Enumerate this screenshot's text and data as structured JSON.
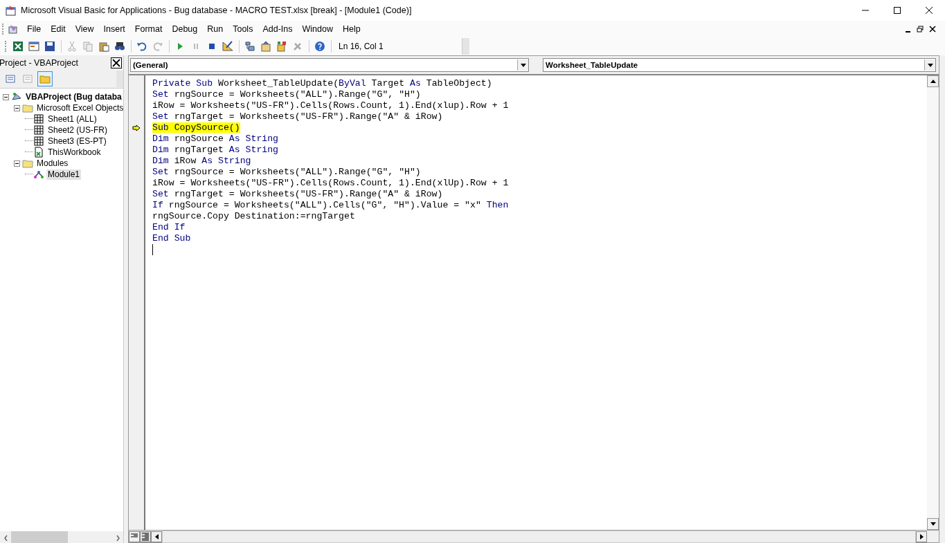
{
  "window": {
    "title": "Microsoft Visual Basic for Applications - Bug database - MACRO TEST.xlsx [break] - [Module1 (Code)]"
  },
  "menu": [
    {
      "label": "File"
    },
    {
      "label": "Edit"
    },
    {
      "label": "View"
    },
    {
      "label": "Insert"
    },
    {
      "label": "Format"
    },
    {
      "label": "Debug"
    },
    {
      "label": "Run"
    },
    {
      "label": "Tools"
    },
    {
      "label": "Add-Ins"
    },
    {
      "label": "Window"
    },
    {
      "label": "Help"
    }
  ],
  "toolbar": {
    "position": "Ln 16, Col 1"
  },
  "project_panel": {
    "title": "Project - VBAProject",
    "tree": [
      {
        "label": "VBAProject (Bug databa",
        "kind": "project",
        "expanded": true,
        "selected": false,
        "children": [
          {
            "label": "Microsoft Excel Objects",
            "kind": "folder",
            "expanded": true,
            "selected": false,
            "children": [
              {
                "label": "Sheet1 (ALL)",
                "kind": "sheet",
                "selected": false
              },
              {
                "label": "Sheet2 (US-FR)",
                "kind": "sheet",
                "selected": false
              },
              {
                "label": "Sheet3 (ES-PT)",
                "kind": "sheet",
                "selected": false
              },
              {
                "label": "ThisWorkbook",
                "kind": "workbook",
                "selected": false
              }
            ]
          },
          {
            "label": "Modules",
            "kind": "folder",
            "expanded": true,
            "selected": false,
            "children": [
              {
                "label": "Module1",
                "kind": "module",
                "selected": true
              }
            ]
          }
        ]
      }
    ]
  },
  "code_window": {
    "object_dropdown": "(General)",
    "procedure_dropdown": "Worksheet_TableUpdate",
    "lines": [
      {
        "current": false,
        "tokens": [
          {
            "kind": "keyword",
            "text": "Private Sub"
          },
          {
            "kind": "plain",
            "text": " Worksheet_TableUpdate("
          },
          {
            "kind": "keyword",
            "text": "ByVal"
          },
          {
            "kind": "plain",
            "text": " Target "
          },
          {
            "kind": "keyword",
            "text": "As"
          },
          {
            "kind": "plain",
            "text": " TableObject)"
          }
        ]
      },
      {
        "current": false,
        "tokens": [
          {
            "kind": "keyword",
            "text": "Set"
          },
          {
            "kind": "plain",
            "text": " rngSource = Worksheets(\"ALL\").Range(\"G\", \"H\")"
          }
        ]
      },
      {
        "current": false,
        "tokens": [
          {
            "kind": "plain",
            "text": "iRow = Worksheets(\"US-FR\").Cells(Rows.Count, 1).End(xlup).Row + 1"
          }
        ]
      },
      {
        "current": false,
        "tokens": [
          {
            "kind": "keyword",
            "text": "Set"
          },
          {
            "kind": "plain",
            "text": " rngTarget = Worksheets(\"US-FR\").Range(\"A\" & iRow)"
          }
        ]
      },
      {
        "current": true,
        "tokens": [
          {
            "kind": "keyword",
            "text": "Sub"
          },
          {
            "kind": "plain",
            "text": " CopySource()"
          }
        ]
      },
      {
        "current": false,
        "tokens": [
          {
            "kind": "keyword",
            "text": "Dim"
          },
          {
            "kind": "plain",
            "text": " rngSource "
          },
          {
            "kind": "keyword",
            "text": "As String"
          }
        ]
      },
      {
        "current": false,
        "tokens": [
          {
            "kind": "keyword",
            "text": "Dim"
          },
          {
            "kind": "plain",
            "text": " rngTarget "
          },
          {
            "kind": "keyword",
            "text": "As String"
          }
        ]
      },
      {
        "current": false,
        "tokens": [
          {
            "kind": "keyword",
            "text": "Dim"
          },
          {
            "kind": "plain",
            "text": " iRow "
          },
          {
            "kind": "keyword",
            "text": "As String"
          }
        ]
      },
      {
        "current": false,
        "tokens": [
          {
            "kind": "keyword",
            "text": "Set"
          },
          {
            "kind": "plain",
            "text": " rngSource = Worksheets(\"ALL\").Range(\"G\", \"H\")"
          }
        ]
      },
      {
        "current": false,
        "tokens": [
          {
            "kind": "plain",
            "text": "iRow = Worksheets(\"US-FR\").Cells(Rows.Count, 1).End(xlUp).Row + 1"
          }
        ]
      },
      {
        "current": false,
        "tokens": [
          {
            "kind": "keyword",
            "text": "Set"
          },
          {
            "kind": "plain",
            "text": " rngTarget = Worksheets(\"US-FR\").Range(\"A\" & iRow)"
          }
        ]
      },
      {
        "current": false,
        "tokens": [
          {
            "kind": "keyword",
            "text": "If"
          },
          {
            "kind": "plain",
            "text": " rngSource = Worksheets(\"ALL\").Cells(\"G\", \"H\").Value = \"x\" "
          },
          {
            "kind": "keyword",
            "text": "Then"
          }
        ]
      },
      {
        "current": false,
        "tokens": [
          {
            "kind": "plain",
            "text": "rngSource.Copy Destination:=rngTarget"
          }
        ]
      },
      {
        "current": false,
        "tokens": [
          {
            "kind": "keyword",
            "text": "End If"
          }
        ]
      },
      {
        "current": false,
        "tokens": [
          {
            "kind": "keyword",
            "text": "End Sub"
          }
        ]
      }
    ]
  }
}
